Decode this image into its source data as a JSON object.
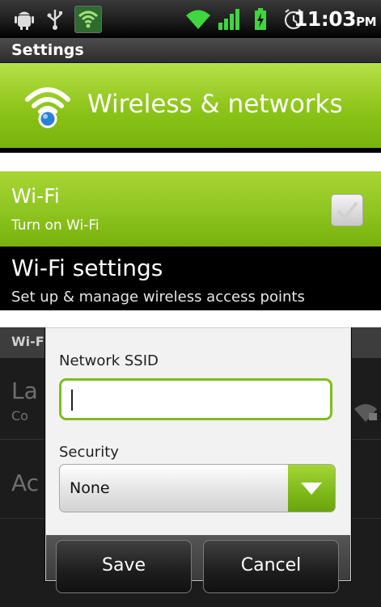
{
  "status_bar": {
    "time": "11:03",
    "ampm": "PM",
    "icons": [
      "android-debug-icon",
      "usb-icon",
      "wifi-notification-icon",
      "wifi-signal-icon",
      "cell-signal-icon",
      "battery-charging-icon",
      "alarm-icon"
    ]
  },
  "panel1": {
    "title": "Settings",
    "wireless_label": "Wireless & networks"
  },
  "panel2": {
    "wifi_title": "Wi-Fi",
    "wifi_subtitle": "Turn on Wi-Fi",
    "wifi_checked": true,
    "wifi_settings_title": "Wi-Fi settings",
    "wifi_settings_subtitle": "Set up & manage wireless access points"
  },
  "panel3": {
    "background": {
      "header": "Wi-F",
      "row1_title": "La",
      "row1_sub": "Co",
      "row2_title": "Ac"
    },
    "dialog": {
      "ssid_label": "Network SSID",
      "ssid_value": "",
      "security_label": "Security",
      "security_value": "None",
      "save_label": "Save",
      "cancel_label": "Cancel"
    }
  },
  "colors": {
    "accent_green": "#8cc418",
    "input_focus": "#7fbd1e"
  }
}
